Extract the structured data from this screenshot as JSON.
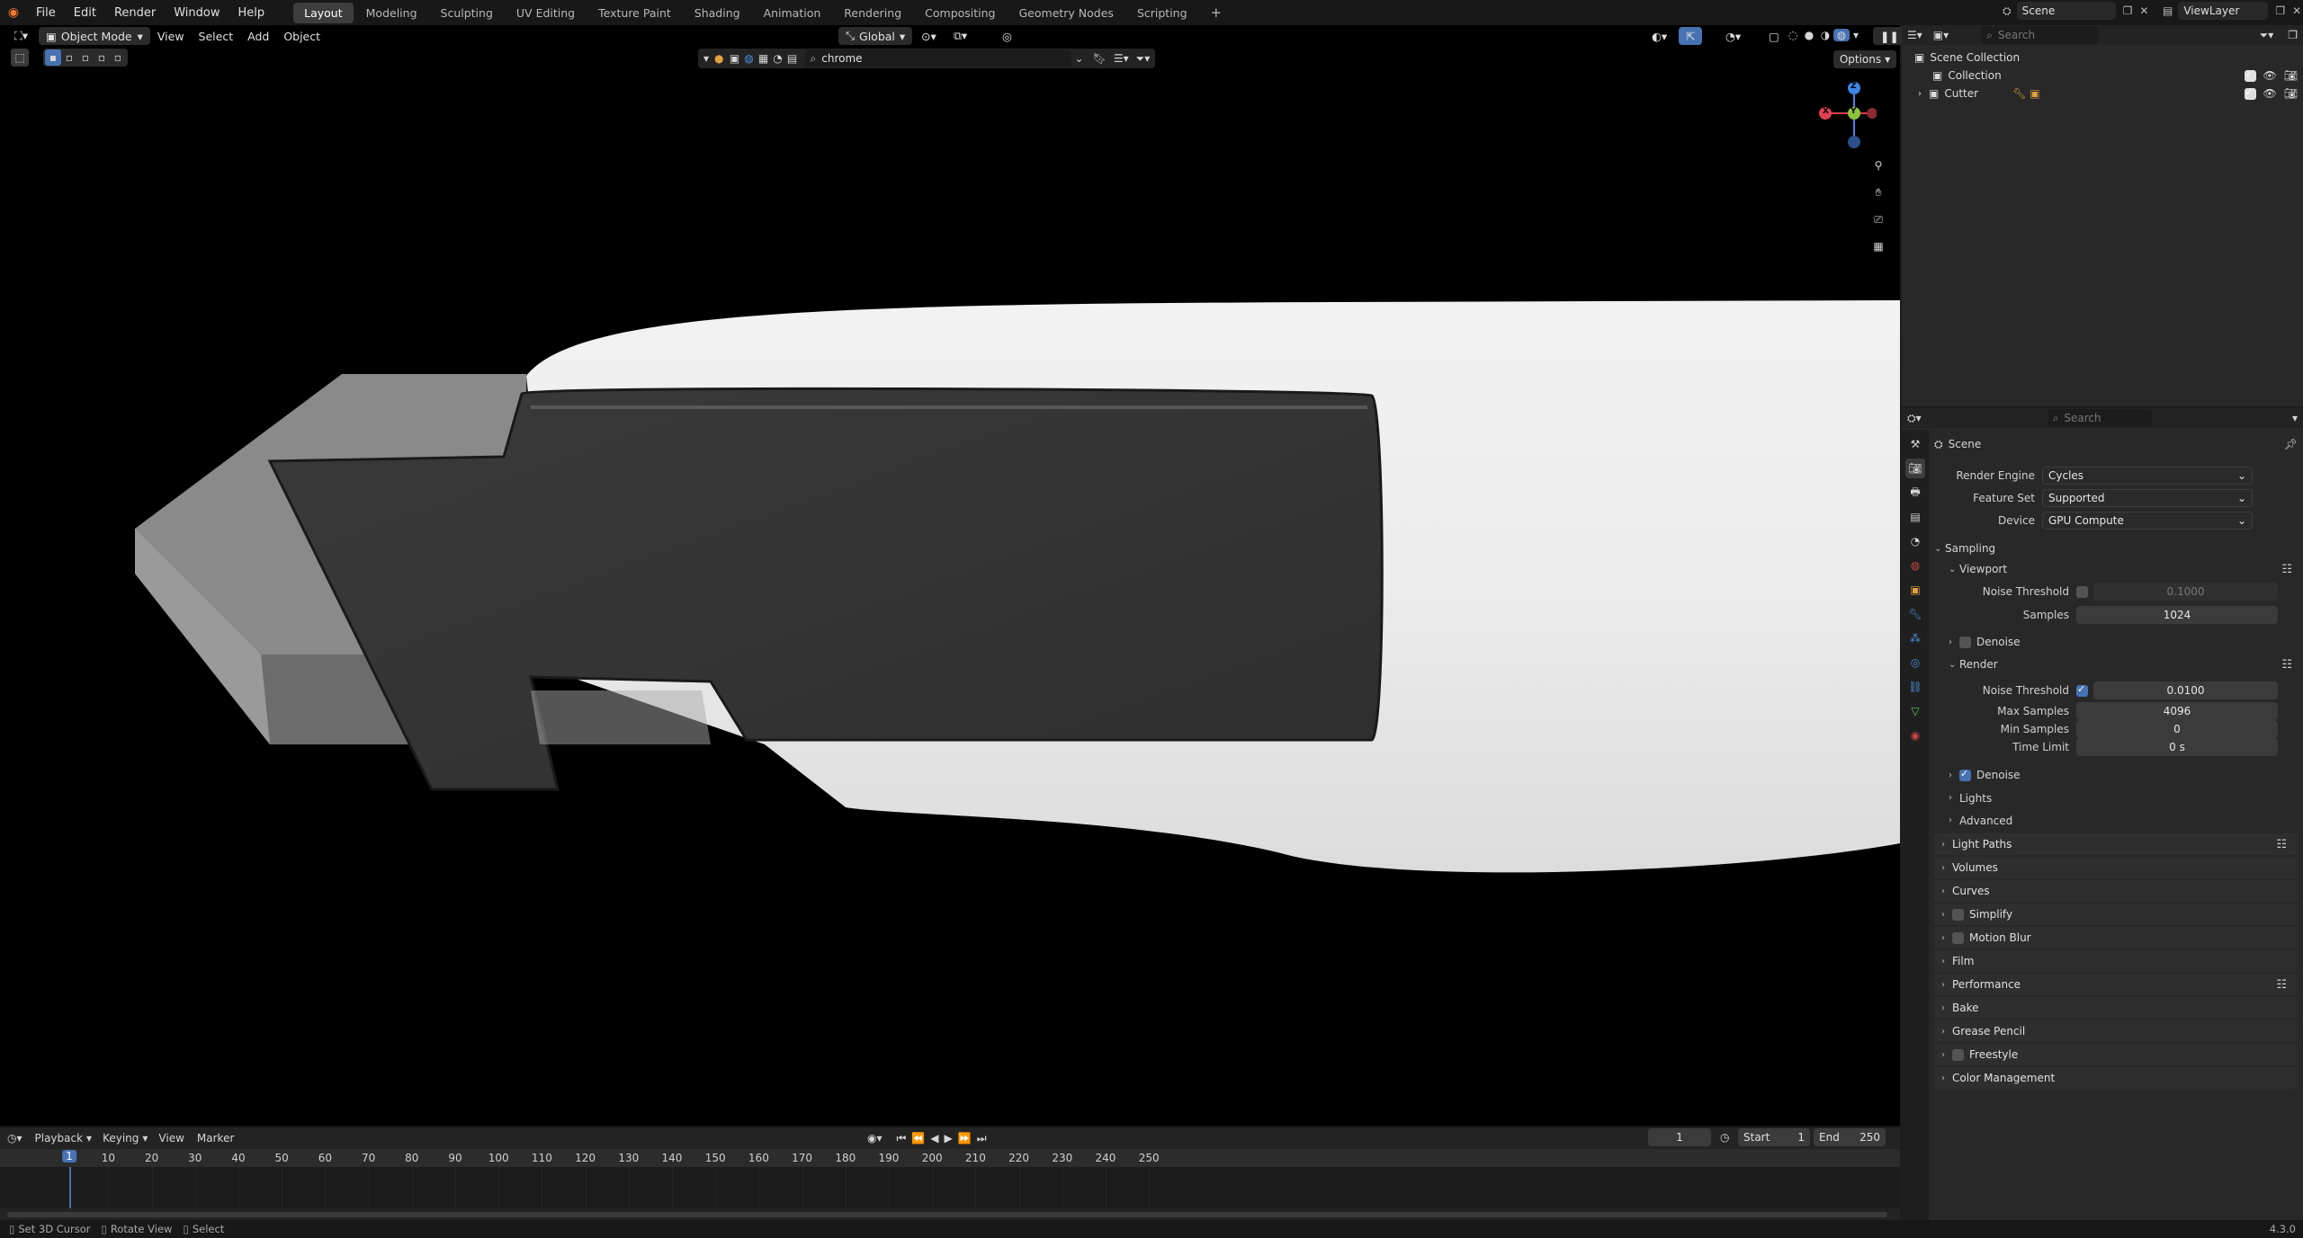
{
  "menu": [
    "File",
    "Edit",
    "Render",
    "Window",
    "Help"
  ],
  "workspaces": [
    "Layout",
    "Modeling",
    "Sculpting",
    "UV Editing",
    "Texture Paint",
    "Shading",
    "Animation",
    "Rendering",
    "Compositing",
    "Geometry Nodes",
    "Scripting"
  ],
  "active_workspace": "Layout",
  "scene_name": "Scene",
  "view_layer": "ViewLayer",
  "viewport": {
    "mode": "Object Mode",
    "menus": [
      "View",
      "Select",
      "Add",
      "Object"
    ],
    "orientation": "Global",
    "search_text": "chrome",
    "options_label": "Options",
    "gizmo": {
      "z": "Z",
      "y": "Y",
      "x": "X"
    }
  },
  "timeline": {
    "menus": [
      "Playback",
      "Keying",
      "View",
      "Marker"
    ],
    "current_frame": "1",
    "start_label": "Start",
    "start": "1",
    "end_label": "End",
    "end": "250",
    "ticks": [
      "1",
      "10",
      "20",
      "30",
      "40",
      "50",
      "60",
      "70",
      "80",
      "90",
      "100",
      "110",
      "120",
      "130",
      "140",
      "150",
      "160",
      "170",
      "180",
      "190",
      "200",
      "210",
      "220",
      "230",
      "240",
      "250"
    ]
  },
  "status": {
    "items": [
      "Set 3D Cursor",
      "Rotate View",
      "Select"
    ],
    "version": "4.3.0"
  },
  "outliner": {
    "search_placeholder": "Search",
    "root": "Scene Collection",
    "items": [
      "Collection",
      "Cutter"
    ]
  },
  "properties": {
    "search_placeholder": "Search",
    "context": "Scene",
    "render_engine_label": "Render Engine",
    "render_engine": "Cycles",
    "feature_set_label": "Feature Set",
    "feature_set": "Supported",
    "device_label": "Device",
    "device": "GPU Compute",
    "sampling": "Sampling",
    "viewport": "Viewport",
    "vp_noise_threshold_label": "Noise Threshold",
    "vp_noise_threshold": "0.1000",
    "vp_samples_label": "Samples",
    "vp_samples": "1024",
    "vp_denoise": "Denoise",
    "render": "Render",
    "r_noise_threshold_label": "Noise Threshold",
    "r_noise_threshold": "0.0100",
    "max_samples_label": "Max Samples",
    "max_samples": "4096",
    "min_samples_label": "Min Samples",
    "min_samples": "0",
    "time_limit_label": "Time Limit",
    "time_limit": "0 s",
    "r_denoise": "Denoise",
    "lights": "Lights",
    "advanced": "Advanced",
    "panels": [
      "Light Paths",
      "Volumes",
      "Curves",
      "Simplify",
      "Motion Blur",
      "Film",
      "Performance",
      "Bake",
      "Grease Pencil",
      "Freestyle",
      "Color Management"
    ]
  },
  "colors": {
    "accent": "#4772b3",
    "axis_x": "#e0404f",
    "axis_y": "#8bc43a",
    "axis_z": "#3f84e5"
  }
}
